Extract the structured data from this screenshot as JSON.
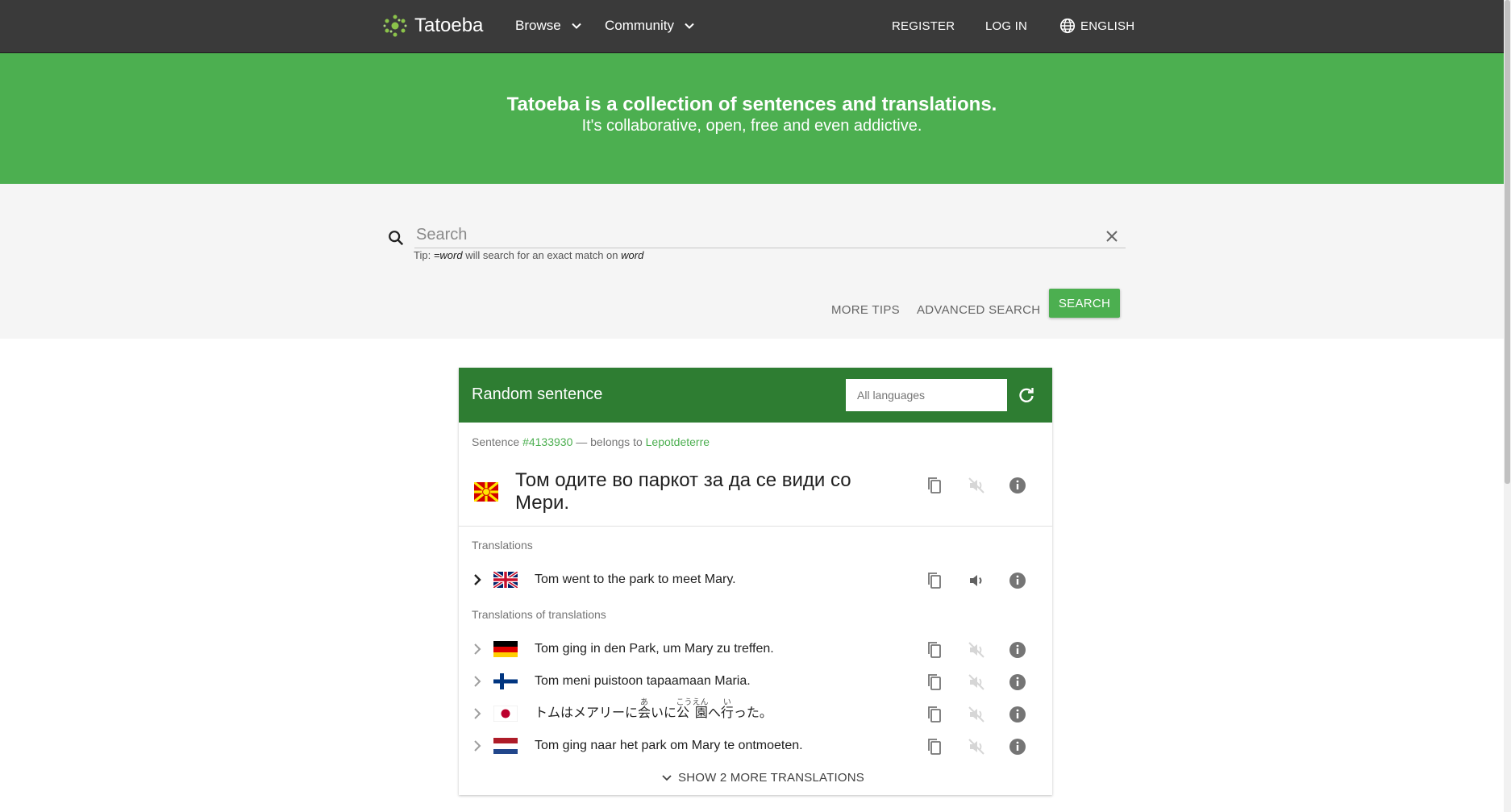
{
  "nav": {
    "logo_text": "Tatoeba",
    "browse": "Browse",
    "community": "Community",
    "register": "REGISTER",
    "login": "LOG IN",
    "language": "ENGLISH"
  },
  "hero": {
    "title": "Tatoeba is a collection of sentences and translations.",
    "subtitle": "It's collaborative, open, free and even addictive."
  },
  "search": {
    "placeholder": "Search",
    "value": "",
    "tip_prefix": "Tip: ",
    "tip_code": "=word",
    "tip_middle": " will search for an exact match on ",
    "tip_word": "word",
    "more_tips": "MORE TIPS",
    "advanced": "ADVANCED SEARCH",
    "button": "SEARCH"
  },
  "random": {
    "title": "Random sentence",
    "lang_placeholder": "All languages",
    "meta_prefix": "Sentence ",
    "sentence_id": "#4133930",
    "meta_middle": " — belongs to ",
    "owner": "Lepotdeterre",
    "sentence": "Том одите во паркот за да се види со Мери.",
    "translations_label": "Translations",
    "translations": [
      {
        "lang": "English",
        "text": "Tom went to the park to meet Mary."
      }
    ],
    "tot_label": "Translations of translations",
    "indirect": [
      {
        "lang": "German",
        "text": "Tom ging in den Park, um Mary zu treffen."
      },
      {
        "lang": "Finnish",
        "text": "Tom meni puistoon tapaamaan Maria."
      },
      {
        "lang": "Japanese",
        "text_before": "トムはメアリーに",
        "r1_base": "会",
        "r1_rt": "あ",
        "text_mid1": "いに",
        "r2_base": "公 園",
        "r2_rt": "こうえん",
        "text_mid2": "へ",
        "r3_base": "行",
        "r3_rt": "い",
        "text_after": "った。"
      },
      {
        "lang": "Dutch",
        "text": "Tom ging naar het park om Mary te ontmoeten."
      }
    ],
    "show_more": "SHOW 2 MORE TRANSLATIONS"
  },
  "colors": {
    "topbar": "#3a3a3a",
    "hero": "#4caf50",
    "card_header": "#2e7d32",
    "link": "#4caf50"
  }
}
